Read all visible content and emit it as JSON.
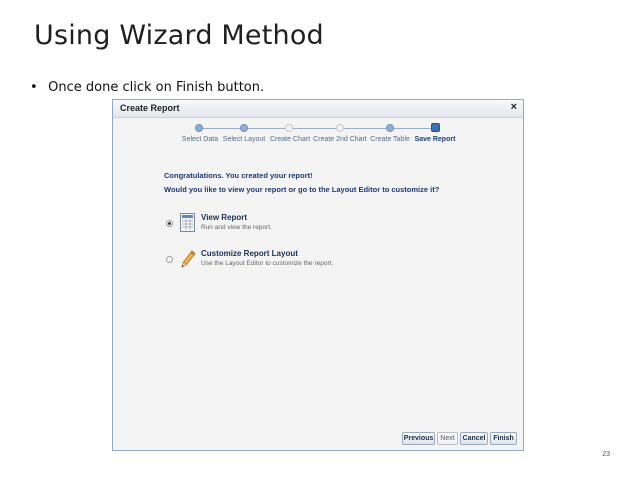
{
  "slide": {
    "title": "Using Wizard Method",
    "bullet_marker": "•",
    "bullet_text": "Once done click on Finish button.",
    "page_number": "23"
  },
  "dialog": {
    "title": "Create Report",
    "close_glyph": "×",
    "steps": [
      {
        "label": "Select Data",
        "state": "done"
      },
      {
        "label": "Select Layout",
        "state": "done"
      },
      {
        "label": "Create Chart",
        "state": "pending"
      },
      {
        "label": "Create 2nd Chart",
        "state": "pending"
      },
      {
        "label": "Create Table",
        "state": "done"
      },
      {
        "label": "Save Report",
        "state": "current"
      }
    ],
    "congrats": "Congratulations. You created your report!",
    "question": "Would you like to view your report or go to the Layout Editor to customize it?",
    "options": [
      {
        "title": "View Report",
        "desc": "Run and view the report.",
        "selected": true,
        "icon": "report-table-icon"
      },
      {
        "title": "Customize Report Layout",
        "desc": "Use the Layout Editor to customize the report.",
        "selected": false,
        "icon": "pencil-icon"
      }
    ],
    "buttons": {
      "previous": "Previous",
      "next": "Next",
      "cancel": "Cancel",
      "finish": "Finish"
    }
  }
}
